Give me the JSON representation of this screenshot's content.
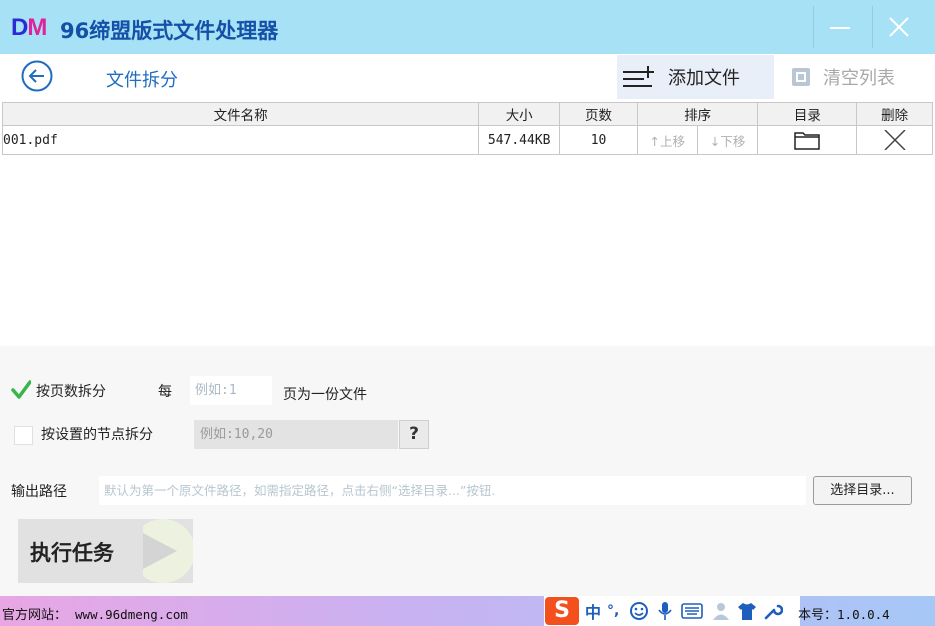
{
  "app": {
    "logo_d": "D",
    "logo_m": "M",
    "title": "96缔盟版式文件处理器"
  },
  "header": {
    "page_title": "文件拆分",
    "add_label": "添加文件",
    "clear_label": "清空列表"
  },
  "table": {
    "columns": [
      "文件名称",
      "大小",
      "页数",
      "排序",
      "目录",
      "删除"
    ],
    "rows": [
      {
        "name": "001.pdf",
        "size": "547.44KB",
        "pages": "10",
        "move_up": "上移",
        "move_down": "下移"
      }
    ]
  },
  "options": {
    "by_pages_label": "按页数拆分",
    "by_pages_checked": true,
    "every_label": "每",
    "pages_placeholder": "例如:1",
    "pages_suffix": "页为一份文件",
    "by_nodes_label": "按设置的节点拆分",
    "by_nodes_checked": false,
    "nodes_placeholder": "例如:10,20",
    "help_label": "?"
  },
  "output": {
    "label": "输出路径",
    "placeholder": "默认为第一个原文件路径，如需指定路径，点击右侧“选择目录...”按钮.",
    "choose_label": "选择目录..."
  },
  "run": {
    "label": "执行任务"
  },
  "status": {
    "site_label": "官方网站：",
    "site_url": "www.96dmeng.com",
    "version_label": "本号：",
    "version": "1.0.0.4",
    "ime_s": "S",
    "ime_mode": "中",
    "ime_punct": "°,"
  },
  "colors": {
    "titlebar": "#a6e1f6",
    "accent": "#1f6cc0",
    "check": "#3ab54a",
    "ime": "#f3501e"
  }
}
